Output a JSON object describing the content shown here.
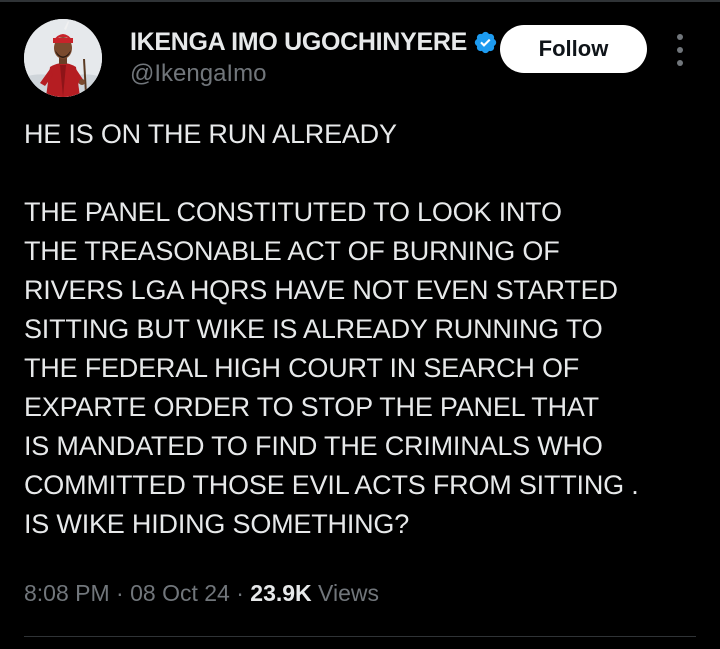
{
  "author": {
    "display_name": "IKENGA IMO UGOCHINYERE",
    "handle": "@IkengaImo",
    "verified": true
  },
  "follow_button": {
    "label": "Follow"
  },
  "tweet": {
    "headline": "HE IS ON THE RUN ALREADY",
    "body": "THE PANEL CONSTITUTED TO LOOK INTO\nTHE TREASONABLE ACT OF BURNING OF\nRIVERS LGA HQRS HAVE NOT EVEN STARTED\nSITTING BUT WIKE IS ALREADY RUNNING TO\nTHE FEDERAL HIGH COURT IN SEARCH OF\nEXPARTE ORDER TO STOP THE PANEL THAT\nIS MANDATED TO FIND THE CRIMINALS WHO\nCOMMITTED THOSE EVIL ACTS FROM SITTING .\nIS WIKE HIDING SOMETHING?"
  },
  "meta": {
    "time": "8:08 PM",
    "separator": " · ",
    "date": "08 Oct 24",
    "views_count": "23.9K",
    "views_label": " Views"
  },
  "colors": {
    "background": "#000000",
    "text_primary": "#e7e9ea",
    "text_secondary": "#71767b",
    "verified_badge": "#1d9bf0",
    "divider": "#2f3336"
  },
  "icons": {
    "verified": "verified-badge-icon",
    "more": "more-options-icon"
  }
}
